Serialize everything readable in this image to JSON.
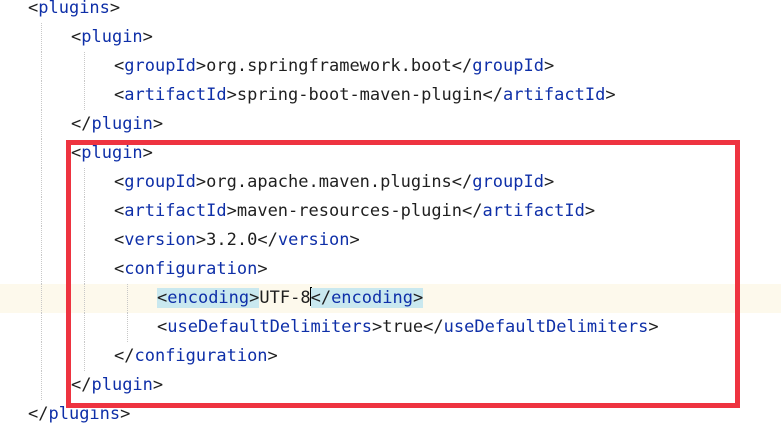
{
  "editor": {
    "lines": [
      {
        "indent": 0,
        "before": "<",
        "tag": "plugins",
        "after": ">",
        "text": "",
        "close": "",
        "close_tag": "",
        "close_end": ""
      },
      {
        "indent": 1,
        "before": "<",
        "tag": "plugin",
        "after": ">",
        "text": "",
        "close": "",
        "close_tag": "",
        "close_end": ""
      },
      {
        "indent": 2,
        "before": "<",
        "tag": "groupId",
        "after": ">",
        "text": "org.springframework.boot",
        "close": "</",
        "close_tag": "groupId",
        "close_end": ">"
      },
      {
        "indent": 2,
        "before": "<",
        "tag": "artifactId",
        "after": ">",
        "text": "spring-boot-maven-plugin",
        "close": "</",
        "close_tag": "artifactId",
        "close_end": ">"
      },
      {
        "indent": 1,
        "before": "</",
        "tag": "plugin",
        "after": ">",
        "text": "",
        "close": "",
        "close_tag": "",
        "close_end": ""
      },
      {
        "indent": 1,
        "before": "<",
        "tag": "plugin",
        "after": ">",
        "text": "",
        "close": "",
        "close_tag": "",
        "close_end": ""
      },
      {
        "indent": 2,
        "before": "<",
        "tag": "groupId",
        "after": ">",
        "text": "org.apache.maven.plugins",
        "close": "</",
        "close_tag": "groupId",
        "close_end": ">"
      },
      {
        "indent": 2,
        "before": "<",
        "tag": "artifactId",
        "after": ">",
        "text": "maven-resources-plugin",
        "close": "</",
        "close_tag": "artifactId",
        "close_end": ">"
      },
      {
        "indent": 2,
        "before": "<",
        "tag": "version",
        "after": ">",
        "text": "3.2.0",
        "close": "</",
        "close_tag": "version",
        "close_end": ">"
      },
      {
        "indent": 2,
        "before": "<",
        "tag": "configuration",
        "after": ">",
        "text": "",
        "close": "",
        "close_tag": "",
        "close_end": ""
      },
      {
        "indent": 3,
        "before": "<",
        "tag": "encoding",
        "after": ">",
        "text": "UTF-8",
        "close": "</",
        "close_tag": "encoding",
        "close_end": ">"
      },
      {
        "indent": 3,
        "before": "<",
        "tag": "useDefaultDelimiters",
        "after": ">",
        "text": "true",
        "close": "</",
        "close_tag": "useDefaultDelimiters",
        "close_end": ">"
      },
      {
        "indent": 2,
        "before": "</",
        "tag": "configuration",
        "after": ">",
        "text": "",
        "close": "",
        "close_tag": "",
        "close_end": ""
      },
      {
        "indent": 1,
        "before": "</",
        "tag": "plugin",
        "after": ">",
        "text": "",
        "close": "",
        "close_tag": "",
        "close_end": ""
      },
      {
        "indent": 0,
        "before": "</",
        "tag": "plugins",
        "after": ">",
        "text": "",
        "close": "",
        "close_tag": "",
        "close_end": ""
      }
    ]
  },
  "colors": {
    "tag": "#0e2fa8",
    "text": "#1f1f1f",
    "current_line": "#fdf9ec",
    "match_highlight": "#c9e8ef",
    "annotation_box": "#ee3340"
  }
}
